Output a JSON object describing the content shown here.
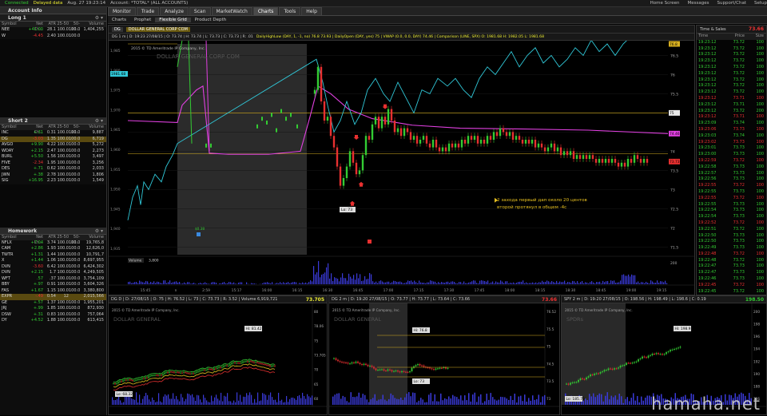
{
  "topbar": {
    "status": "Connected",
    "delayed": "Delayed data",
    "datetime": "Aug. 27 19:23:14",
    "account": "Account: *TOTAL* (ALL ACCOUNTS)",
    "home": "Home Screen",
    "messages": "Messages",
    "support": "Support/Chat",
    "setup": "Setup"
  },
  "left": {
    "account_info": "Account Info",
    "long_title": "Long 1",
    "long_rows": [
      {
        "sym": "NEE",
        "chg": "+41.00",
        "atr": "28.1",
        "a": "100.0",
        "b": "100.0",
        "vol": "1,404,255"
      },
      {
        "sym": "W",
        "chg": "-4.45",
        "atr": "2.40",
        "a": "100.0",
        "b": "100.0",
        "vol": ""
      }
    ],
    "short_title": "Short 2",
    "cols": [
      "Symbol",
      "Net Ch...",
      "ATR",
      "25-50",
      "50-10...",
      "Volume"
    ],
    "short_rows": [
      {
        "sym": "INC",
        "chg": "+.31",
        "atr": "0.31",
        "a": "100.0",
        "b": "100.0",
        "vol": "9,887"
      },
      {
        "sym": "DG",
        "chg": "-3.03",
        "atr": "1.35",
        "a": "100.0",
        "b": "100.0",
        "vol": "6,719"
      },
      {
        "sym": "AVGO",
        "chg": "+9.90",
        "atr": "4.22",
        "a": "100.0",
        "b": "100.0",
        "vol": "5,272"
      },
      {
        "sym": "WDAY",
        "chg": "+2.15",
        "atr": "2.47",
        "a": "100.0",
        "b": "100.0",
        "vol": "2,273"
      },
      {
        "sym": "BURL",
        "chg": "+5.50",
        "atr": "1.56",
        "a": "100.0",
        "b": "100.0",
        "vol": "3,497"
      },
      {
        "sym": "FIVE",
        "chg": "-2.34",
        "atr": "1.95",
        "a": "100.0",
        "b": "100.0",
        "vol": "3,256"
      },
      {
        "sym": "DES",
        "chg": "+.71",
        "atr": "0.62",
        "a": "100.0",
        "b": "100.0",
        "vol": "2,033"
      },
      {
        "sym": "JWN",
        "chg": "+.38",
        "atr": "2.78",
        "a": "100.0",
        "b": "100.0",
        "vol": "1,806"
      },
      {
        "sym": "SIG",
        "chg": "+16.95",
        "atr": "2.23",
        "a": "100.0",
        "b": "100.0",
        "vol": "1,549"
      }
    ],
    "homework_title": "Homework",
    "homework_rows": [
      {
        "sym": "NFLX",
        "chg": "+7.04",
        "atr": "3.74",
        "a": "100.0",
        "b": "100.0",
        "vol": "19,765,8"
      },
      {
        "sym": "CAM",
        "chg": "+2.86",
        "atr": "1.93",
        "a": "100.0",
        "b": "100.0",
        "vol": "12,626,0"
      },
      {
        "sym": "TWTR",
        "chg": "+1.31",
        "atr": "1.44",
        "a": "100.0",
        "b": "100.0",
        "vol": "10,791,7"
      },
      {
        "sym": "X",
        "chg": "+1.44",
        "atr": "1.06",
        "a": "100.0",
        "b": "100.0",
        "vol": "8,697,955"
      },
      {
        "sym": "DVN",
        "chg": "-3.60",
        "atr": "6.42",
        "a": "100.0",
        "b": "100.0",
        "vol": "6,424,302"
      },
      {
        "sym": "DVN",
        "chg": "+2.15",
        "atr": "1.7",
        "a": "100.0",
        "b": "100.0",
        "vol": "4,249,505"
      },
      {
        "sym": "WFT",
        "chg": ".57",
        "atr": ".37",
        "a": "100.0",
        "b": "100.0",
        "vol": "3,754,109"
      },
      {
        "sym": "BBY",
        "chg": "+.97",
        "atr": "0.91",
        "a": "100.0",
        "b": "100.0",
        "vol": "3,604,326"
      },
      {
        "sym": "FAS",
        "chg": "+1.67",
        "atr": "1.15",
        "a": "100.0",
        "b": "100.0",
        "vol": "3,380,800"
      },
      {
        "sym": "EXPR",
        "chg": "-.49",
        "atr": "0.54",
        "a": "12",
        "b": "",
        "vol": "2,015,566"
      },
      {
        "sym": "GE",
        "chg": "+.57",
        "atr": "1.37",
        "a": "100.0",
        "b": "100.0",
        "vol": "1,955,201"
      },
      {
        "sym": "JRJ",
        "chg": "+.99",
        "atr": "1.85",
        "a": "100.0",
        "b": "100.0",
        "vol": "872,930"
      },
      {
        "sym": "DSW",
        "chg": "+.31",
        "atr": "0.83",
        "a": "100.0",
        "b": "100.0",
        "vol": "757,064"
      },
      {
        "sym": "DY",
        "chg": "+4.52",
        "atr": "1.88",
        "a": "100.0",
        "b": "100.0",
        "vol": "613,415"
      }
    ]
  },
  "menu": [
    "Monitor",
    "Trade",
    "Analyze",
    "Scan",
    "MarketWatch",
    "Charts",
    "Tools",
    "Help"
  ],
  "submenu": [
    "Charts",
    "Prophet",
    "Flexible Grid",
    "Product Depth"
  ],
  "main_chart": {
    "symbol": "DG",
    "header": "DG 1 m | D: 19:23 27/08/15 | O: 73.74 | H: 73.74 | L: 73.73 | C: 73.73 | R: .01",
    "studies": "DailyHighLow (DAY, 1, -1, no) 76.8 73.93 | DailyOpen (DAY, yes) 75 | VWAP (0.0, 0.0, DAY) 74.46 | Comparison (LINE, SPX) O: 1981.68 H: 1982.05 L: 1981.68",
    "company": "DOLLAR GENERAL CORP COM",
    "copyright": "2015 © TD Ameritrade IP Company, Inc.",
    "last": "73.66",
    "annotation_line1": "2 захода первый дап около 20 центов",
    "annotation_line2": "второй протянул в общем -4c",
    "low_label": "Lo: 73",
    "volume_label": "Volume",
    "volume_value": "3,800",
    "spx_tag": "1981.68",
    "price_ticks": [
      "76.5",
      "76",
      "75.5",
      "75",
      "74.5",
      "74",
      "73.5",
      "73",
      "72.5",
      "72",
      "71.5"
    ],
    "price_tags": [
      "76.8",
      "75",
      "74.46",
      "73.73"
    ],
    "left_ticks": [
      "1,985",
      "1,980",
      "1,975",
      "1,970",
      "1,965",
      "1,960",
      "1,955",
      "1,950",
      "1,945",
      "1,940",
      "1,935"
    ],
    "time_ticks": [
      "15:45",
      "n",
      "2:59",
      "15:17",
      "16:00",
      "16:15",
      "16:30",
      "16:45",
      "17:00",
      "17:15",
      "17:30",
      "17:45",
      "18:00",
      "18:15",
      "18:30",
      "18:45",
      "19:00",
      "19:15"
    ]
  },
  "timesales": {
    "title": "Time & Sales",
    "cols": [
      "Time",
      "Price",
      "Size"
    ],
    "head_price": "73.66",
    "rows": [
      [
        "19:23:12",
        "73.72",
        "100"
      ],
      [
        "19:23:12",
        "73.72",
        "100"
      ],
      [
        "19:23:12",
        "73.72",
        "100"
      ],
      [
        "19:23:12",
        "73.72",
        "100"
      ],
      [
        "19:23:12",
        "73.72",
        "100"
      ],
      [
        "19:23:12",
        "73.72",
        "100"
      ],
      [
        "19:23:12",
        "73.72",
        "100"
      ],
      [
        "19:23:12",
        "73.72",
        "100"
      ],
      [
        "19:23:12",
        "73.72",
        "100"
      ],
      [
        "19:23:12",
        "73.71",
        "100"
      ],
      [
        "19:23:12",
        "73.71",
        "100"
      ],
      [
        "19:23:12",
        "73.72",
        "200"
      ],
      [
        "19:23:12",
        "73.71",
        "100"
      ],
      [
        "19:23:09",
        "73.74",
        "100"
      ],
      [
        "19:23:06",
        "73.73",
        "100"
      ],
      [
        "19:23:03",
        "73.74",
        "100"
      ],
      [
        "19:23:02",
        "73.73",
        "100"
      ],
      [
        "19:23:01",
        "73.73",
        "100"
      ],
      [
        "19:23:00",
        "73.73",
        "100"
      ],
      [
        "19:22:59",
        "73.72",
        "100"
      ],
      [
        "19:22:58",
        "73.73",
        "100"
      ],
      [
        "19:22:57",
        "73.73",
        "100"
      ],
      [
        "19:22:56",
        "73.73",
        "100"
      ],
      [
        "19:22:55",
        "73.72",
        "100"
      ],
      [
        "19:22:55",
        "73.73",
        "100"
      ],
      [
        "19:22:55",
        "73.72",
        "100"
      ],
      [
        "19:22:55",
        "73.73",
        "100"
      ],
      [
        "19:22:54",
        "73.73",
        "100"
      ],
      [
        "19:22:54",
        "73.73",
        "100"
      ],
      [
        "19:22:52",
        "73.72",
        "100"
      ],
      [
        "19:22:51",
        "73.72",
        "100"
      ],
      [
        "19:22:50",
        "73.73",
        "100"
      ],
      [
        "19:22:50",
        "73.73",
        "100"
      ],
      [
        "19:22:49",
        "73.73",
        "100"
      ],
      [
        "19:22:48",
        "73.72",
        "100"
      ],
      [
        "19:22:48",
        "73.72",
        "100"
      ],
      [
        "19:22:47",
        "73.73",
        "100"
      ],
      [
        "19:22:47",
        "73.73",
        "100"
      ],
      [
        "19:22:46",
        "73.73",
        "100"
      ],
      [
        "19:22:45",
        "73.72",
        "100"
      ],
      [
        "19:22:45",
        "73.72",
        "100"
      ],
      [
        "19:22:45",
        "73.72",
        "100"
      ]
    ]
  },
  "subcharts": [
    {
      "sym": "DG",
      "header": "DG D | D: 27/08/15 | O: 75 | H: 76.52 | L: 73 | C: 73.73 | R: 3.52 | Volume 6,919,721",
      "last": "73.705",
      "company": "DOLLAR GENERAL",
      "hi": "Hi: 81.42",
      "lo": "Lo: 68.32",
      "ticks": [
        "80",
        "78.06",
        "75",
        "73.705",
        "70",
        "65",
        "60"
      ]
    },
    {
      "sym": "DG",
      "header": "DG 2 m | D: 19:20 27/08/15 | O: 73.77 | H: 73.77 | L: 73.64 | C: 73.66",
      "last": "73.66",
      "company": "DOLLAR GENERAL",
      "hi": "Hi: 76.8",
      "lo": "Lo: 73",
      "ticks": [
        "76.52",
        "75.5",
        "75",
        "74.5",
        "73.5",
        "73"
      ]
    },
    {
      "sym": "SPY",
      "header": "SPY 2 m | D: 19:20 27/08/15 | O: 198.56 | H: 198.49 | L: 198.6 | C: 0.19",
      "last": "198.50",
      "company": "SPDRs",
      "hi": "Hi: 198.91",
      "lo": "Lo: 185.79",
      "ticks": [
        "200",
        "198",
        "196",
        "194",
        "192",
        "190",
        "188",
        "186"
      ]
    }
  ],
  "colors": {
    "up": "#33cc33",
    "down": "#e83030",
    "vwap": "#e040e0",
    "spx": "#30c8d8",
    "level": "#d8b020",
    "accent": "#e8c020"
  },
  "watermark": "hamaha.net"
}
